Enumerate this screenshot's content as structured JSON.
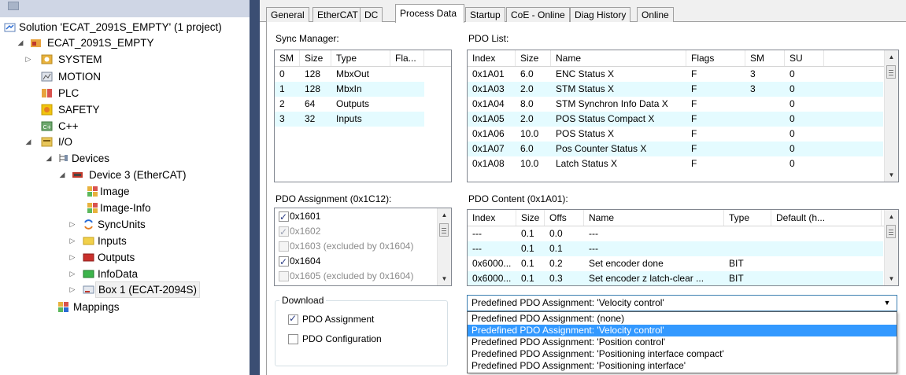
{
  "explorer": {
    "items": [
      {
        "label": "Solution 'ECAT_2091S_EMPTY' (1 project)",
        "icon": "solution-icon"
      },
      {
        "label": "ECAT_2091S_EMPTY",
        "icon": "project-icon"
      },
      {
        "label": "SYSTEM",
        "icon": "system-icon"
      },
      {
        "label": "MOTION",
        "icon": "motion-icon"
      },
      {
        "label": "PLC",
        "icon": "plc-icon"
      },
      {
        "label": "SAFETY",
        "icon": "safety-icon"
      },
      {
        "label": "C++",
        "icon": "cpp-icon"
      },
      {
        "label": "I/O",
        "icon": "io-icon"
      },
      {
        "label": "Devices",
        "icon": "devices-icon"
      },
      {
        "label": "Device 3 (EtherCAT)",
        "icon": "ethercat-device-icon"
      },
      {
        "label": "Image",
        "icon": "image-icon"
      },
      {
        "label": "Image-Info",
        "icon": "image-info-icon"
      },
      {
        "label": "SyncUnits",
        "icon": "syncunits-icon"
      },
      {
        "label": "Inputs",
        "icon": "inputs-icon"
      },
      {
        "label": "Outputs",
        "icon": "outputs-icon"
      },
      {
        "label": "InfoData",
        "icon": "infodata-icon"
      },
      {
        "label": "Box 1 (ECAT-2094S)",
        "icon": "box-icon"
      },
      {
        "label": "Mappings",
        "icon": "mappings-icon"
      }
    ]
  },
  "tabs": [
    "General",
    "EtherCAT",
    "DC",
    "Process Data",
    "Startup",
    "CoE - Online",
    "Diag History",
    "Online"
  ],
  "active_tab": "Process Data",
  "sync_manager": {
    "label": "Sync Manager:",
    "columns": [
      "SM",
      "Size",
      "Type",
      "Fla..."
    ],
    "rows": [
      [
        "0",
        "128",
        "MbxOut",
        ""
      ],
      [
        "1",
        "128",
        "MbxIn",
        ""
      ],
      [
        "2",
        "64",
        "Outputs",
        ""
      ],
      [
        "3",
        "32",
        "Inputs",
        ""
      ]
    ]
  },
  "pdo_list": {
    "label": "PDO List:",
    "columns": [
      "Index",
      "Size",
      "Name",
      "Flags",
      "SM",
      "SU"
    ],
    "rows": [
      [
        "0x1A01",
        "6.0",
        "ENC Status X",
        "F",
        "3",
        "0"
      ],
      [
        "0x1A03",
        "2.0",
        "STM Status X",
        "F",
        "3",
        "0"
      ],
      [
        "0x1A04",
        "8.0",
        "STM Synchron Info Data X",
        "F",
        "",
        "0"
      ],
      [
        "0x1A05",
        "2.0",
        "POS Status Compact X",
        "F",
        "",
        "0"
      ],
      [
        "0x1A06",
        "10.0",
        "POS Status X",
        "F",
        "",
        "0"
      ],
      [
        "0x1A07",
        "6.0",
        "Pos Counter Status X",
        "F",
        "",
        "0"
      ],
      [
        "0x1A08",
        "10.0",
        "Latch Status X",
        "F",
        "",
        "0"
      ]
    ]
  },
  "pdo_assignment": {
    "label": "PDO Assignment (0x1C12):",
    "items": [
      {
        "text": "0x1601",
        "checked": true,
        "enabled": true
      },
      {
        "text": "0x1602",
        "checked": true,
        "enabled": false
      },
      {
        "text": "0x1603 (excluded by 0x1604)",
        "checked": false,
        "enabled": false
      },
      {
        "text": "0x1604",
        "checked": true,
        "enabled": true
      },
      {
        "text": "0x1605 (excluded by 0x1604)",
        "checked": false,
        "enabled": false
      }
    ]
  },
  "pdo_content": {
    "label": "PDO Content (0x1A01):",
    "columns": [
      "Index",
      "Size",
      "Offs",
      "Name",
      "Type",
      "Default (h..."
    ],
    "rows": [
      [
        "---",
        "0.1",
        "0.0",
        "---",
        "",
        ""
      ],
      [
        "---",
        "0.1",
        "0.1",
        "---",
        "",
        ""
      ],
      [
        "0x6000...",
        "0.1",
        "0.2",
        "Set encoder done",
        "BIT",
        ""
      ],
      [
        "0x6000...",
        "0.1",
        "0.3",
        "Set encoder z latch-clear ...",
        "BIT",
        ""
      ]
    ]
  },
  "download": {
    "legend": "Download",
    "pdo_assignment_label": "PDO Assignment",
    "pdo_assignment_checked": true,
    "pdo_configuration_label": "PDO Configuration",
    "pdo_configuration_checked": false
  },
  "predefined": {
    "selected": "Predefined PDO Assignment: 'Velocity control'",
    "options": [
      "Predefined PDO Assignment: (none)",
      "Predefined PDO Assignment: 'Velocity control'",
      "Predefined PDO Assignment: 'Position control'",
      "Predefined PDO Assignment: 'Positioning interface compact'",
      "Predefined PDO Assignment: 'Positioning interface'"
    ],
    "highlighted_index": 1
  },
  "colors": {
    "divider": "#3b4e73",
    "row_alt": "#e4fbff",
    "dropdown_highlight": "#3399ff"
  }
}
